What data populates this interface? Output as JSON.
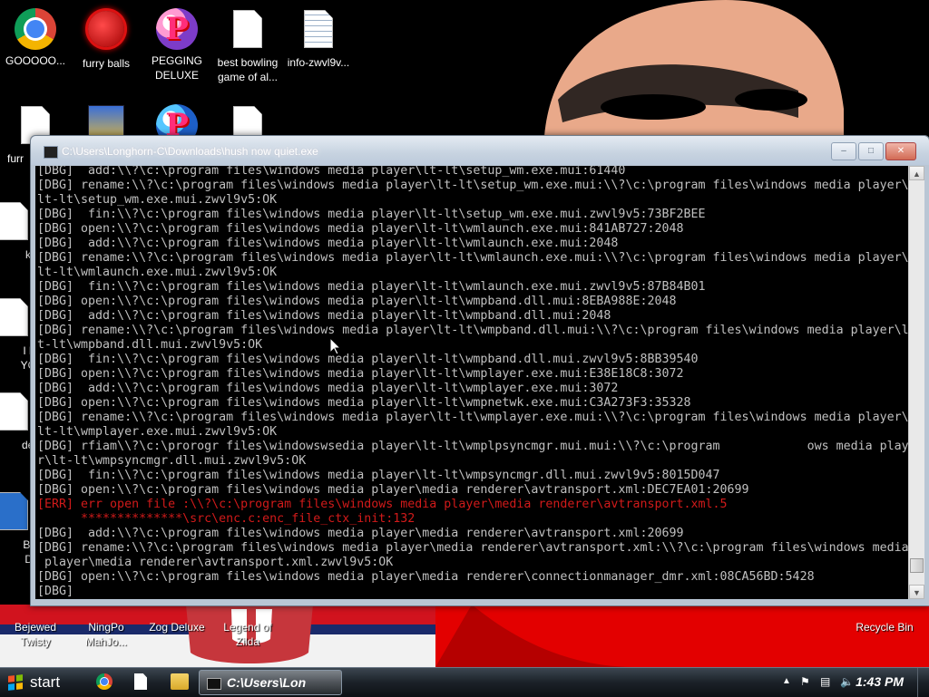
{
  "desktop": {
    "icons": [
      {
        "label": "GOOOOO...",
        "icon": "chrome-icon"
      },
      {
        "label": "furry balls",
        "icon": "furry-balls-icon"
      },
      {
        "label": "PEGGING DELUXE",
        "icon": "pegging-deluxe-icon"
      },
      {
        "label": "best bowling game of al...",
        "icon": "document-icon"
      },
      {
        "label": "info-zwvl9v...",
        "icon": "text-document-icon"
      },
      {
        "label": "furr",
        "icon": "document-icon"
      },
      {
        "label": "k",
        "icon": "document-icon"
      },
      {
        "label": "I k",
        "icon": "document-icon"
      },
      {
        "label": "YO",
        "icon": "document-icon"
      },
      {
        "label": "dee",
        "icon": "document-icon"
      },
      {
        "label": "Be",
        "icon": "application-icon"
      },
      {
        "label": "D",
        "icon": "application-icon"
      },
      {
        "label": "Bejewed Twisty",
        "icon": "bejeweled-twist-icon"
      },
      {
        "label": "NingPo MahJo...",
        "icon": "mahjong-icon"
      },
      {
        "label": "Zog Deluxe",
        "icon": "zog-deluxe-icon"
      },
      {
        "label": "Legend of Zilda",
        "icon": "legend-of-zilda-icon"
      },
      {
        "label": "Recycle Bin",
        "icon": "recycle-bin-icon"
      }
    ]
  },
  "console_window": {
    "title": "C:\\Users\\Longhorn-C\\Downloads\\hush now quiet.exe",
    "buttons": {
      "minimize": "–",
      "maximize": "□",
      "close": "✕"
    },
    "lines": [
      "[DBG]  add:\\\\?\\c:\\program files\\windows media player\\lt-lt\\setup_wm.exe.mui:61440",
      "[DBG] rename:\\\\?\\c:\\program files\\windows media player\\lt-lt\\setup_wm.exe.mui:\\\\?\\c:\\program files\\windows media player\\",
      "lt-lt\\setup_wm.exe.mui.zwvl9v5:OK",
      "[DBG]  fin:\\\\?\\c:\\program files\\windows media player\\lt-lt\\setup_wm.exe.mui.zwvl9v5:73BF2BEE",
      "[DBG] open:\\\\?\\c:\\program files\\windows media player\\lt-lt\\wmlaunch.exe.mui:841AB727:2048",
      "[DBG]  add:\\\\?\\c:\\program files\\windows media player\\lt-lt\\wmlaunch.exe.mui:2048",
      "[DBG] rename:\\\\?\\c:\\program files\\windows media player\\lt-lt\\wmlaunch.exe.mui:\\\\?\\c:\\program files\\windows media player\\",
      "lt-lt\\wmlaunch.exe.mui.zwvl9v5:OK",
      "[DBG]  fin:\\\\?\\c:\\program files\\windows media player\\lt-lt\\wmlaunch.exe.mui.zwvl9v5:87B84B01",
      "[DBG] open:\\\\?\\c:\\program files\\windows media player\\lt-lt\\wmpband.dll.mui:8EBA988E:2048",
      "[DBG]  add:\\\\?\\c:\\program files\\windows media player\\lt-lt\\wmpband.dll.mui:2048",
      "[DBG] rename:\\\\?\\c:\\program files\\windows media player\\lt-lt\\wmpband.dll.mui:\\\\?\\c:\\program files\\windows media player\\l",
      "t-lt\\wmpband.dll.mui.zwvl9v5:OK",
      "[DBG]  fin:\\\\?\\c:\\program files\\windows media player\\lt-lt\\wmpband.dll.mui.zwvl9v5:8BB39540",
      "[DBG] open:\\\\?\\c:\\program files\\windows media player\\lt-lt\\wmplayer.exe.mui:E38E18C8:3072",
      "[DBG]  add:\\\\?\\c:\\program files\\windows media player\\lt-lt\\wmplayer.exe.mui:3072",
      "[DBG] open:\\\\?\\c:\\program files\\windows media player\\lt-lt\\wmpnetwk.exe.mui:C3A273F3:35328",
      "[DBG] rename:\\\\?\\c:\\program files\\windows media player\\lt-lt\\wmplayer.exe.mui:\\\\?\\c:\\program files\\windows media player\\",
      "lt-lt\\wmplayer.exe.mui.zwvl9v5:OK",
      "[DBG] rfiam\\\\?\\c:\\prorogr files\\windowswsedia player\\lt-lt\\wmplpsyncmgr.mui.mui:\\\\?\\c:\\program            ows media playe",
      "r\\lt-lt\\wmpsyncmgr.dll.mui.zwvl9v5:OK",
      "[DBG]  fin:\\\\?\\c:\\program files\\windows media player\\lt-lt\\wmpsyncmgr.dll.mui.zwvl9v5:8015D047",
      "[DBG] open:\\\\?\\c:\\program files\\windows media player\\media renderer\\avtransport.xml:DEC7EA01:20699",
      "[ERR] err open file :\\\\?\\c:\\program files\\windows media player\\media renderer\\avtransport.xml.5",
      "      **************\\src\\enc.c:enc_file_ctx_init:132",
      "[DBG]  add:\\\\?\\c:\\program files\\windows media player\\media renderer\\avtransport.xml:20699",
      "[DBG] rename:\\\\?\\c:\\program files\\windows media player\\media renderer\\avtransport.xml:\\\\?\\c:\\program files\\windows media",
      " player\\media renderer\\avtransport.xml.zwvl9v5:OK",
      "[DBG] open:\\\\?\\c:\\program files\\windows media player\\media renderer\\connectionmanager_dmr.xml:08CA56BD:5428",
      "[DBG]"
    ],
    "error_line_indices": [
      23,
      24
    ],
    "scroll_position": 0.97
  },
  "taskbar": {
    "start_label": "start",
    "quick_launch": [
      "chrome-icon",
      "file-icon",
      "explorer-icon"
    ],
    "active_task_label": "C:\\Users\\Lon",
    "clock": "1:43 PM",
    "tray_icons": [
      "show-hidden-chevron-icon",
      "action-center-flag-icon",
      "network-icon",
      "volume-icon"
    ]
  },
  "colors": {
    "console_background": "#000000",
    "console_text": "#c0c0c0",
    "console_error": "#d11a1a",
    "desktop_background": "#000000",
    "wallpaper_red": "#e30000",
    "wallpaper_skin": "#e9a98a"
  }
}
